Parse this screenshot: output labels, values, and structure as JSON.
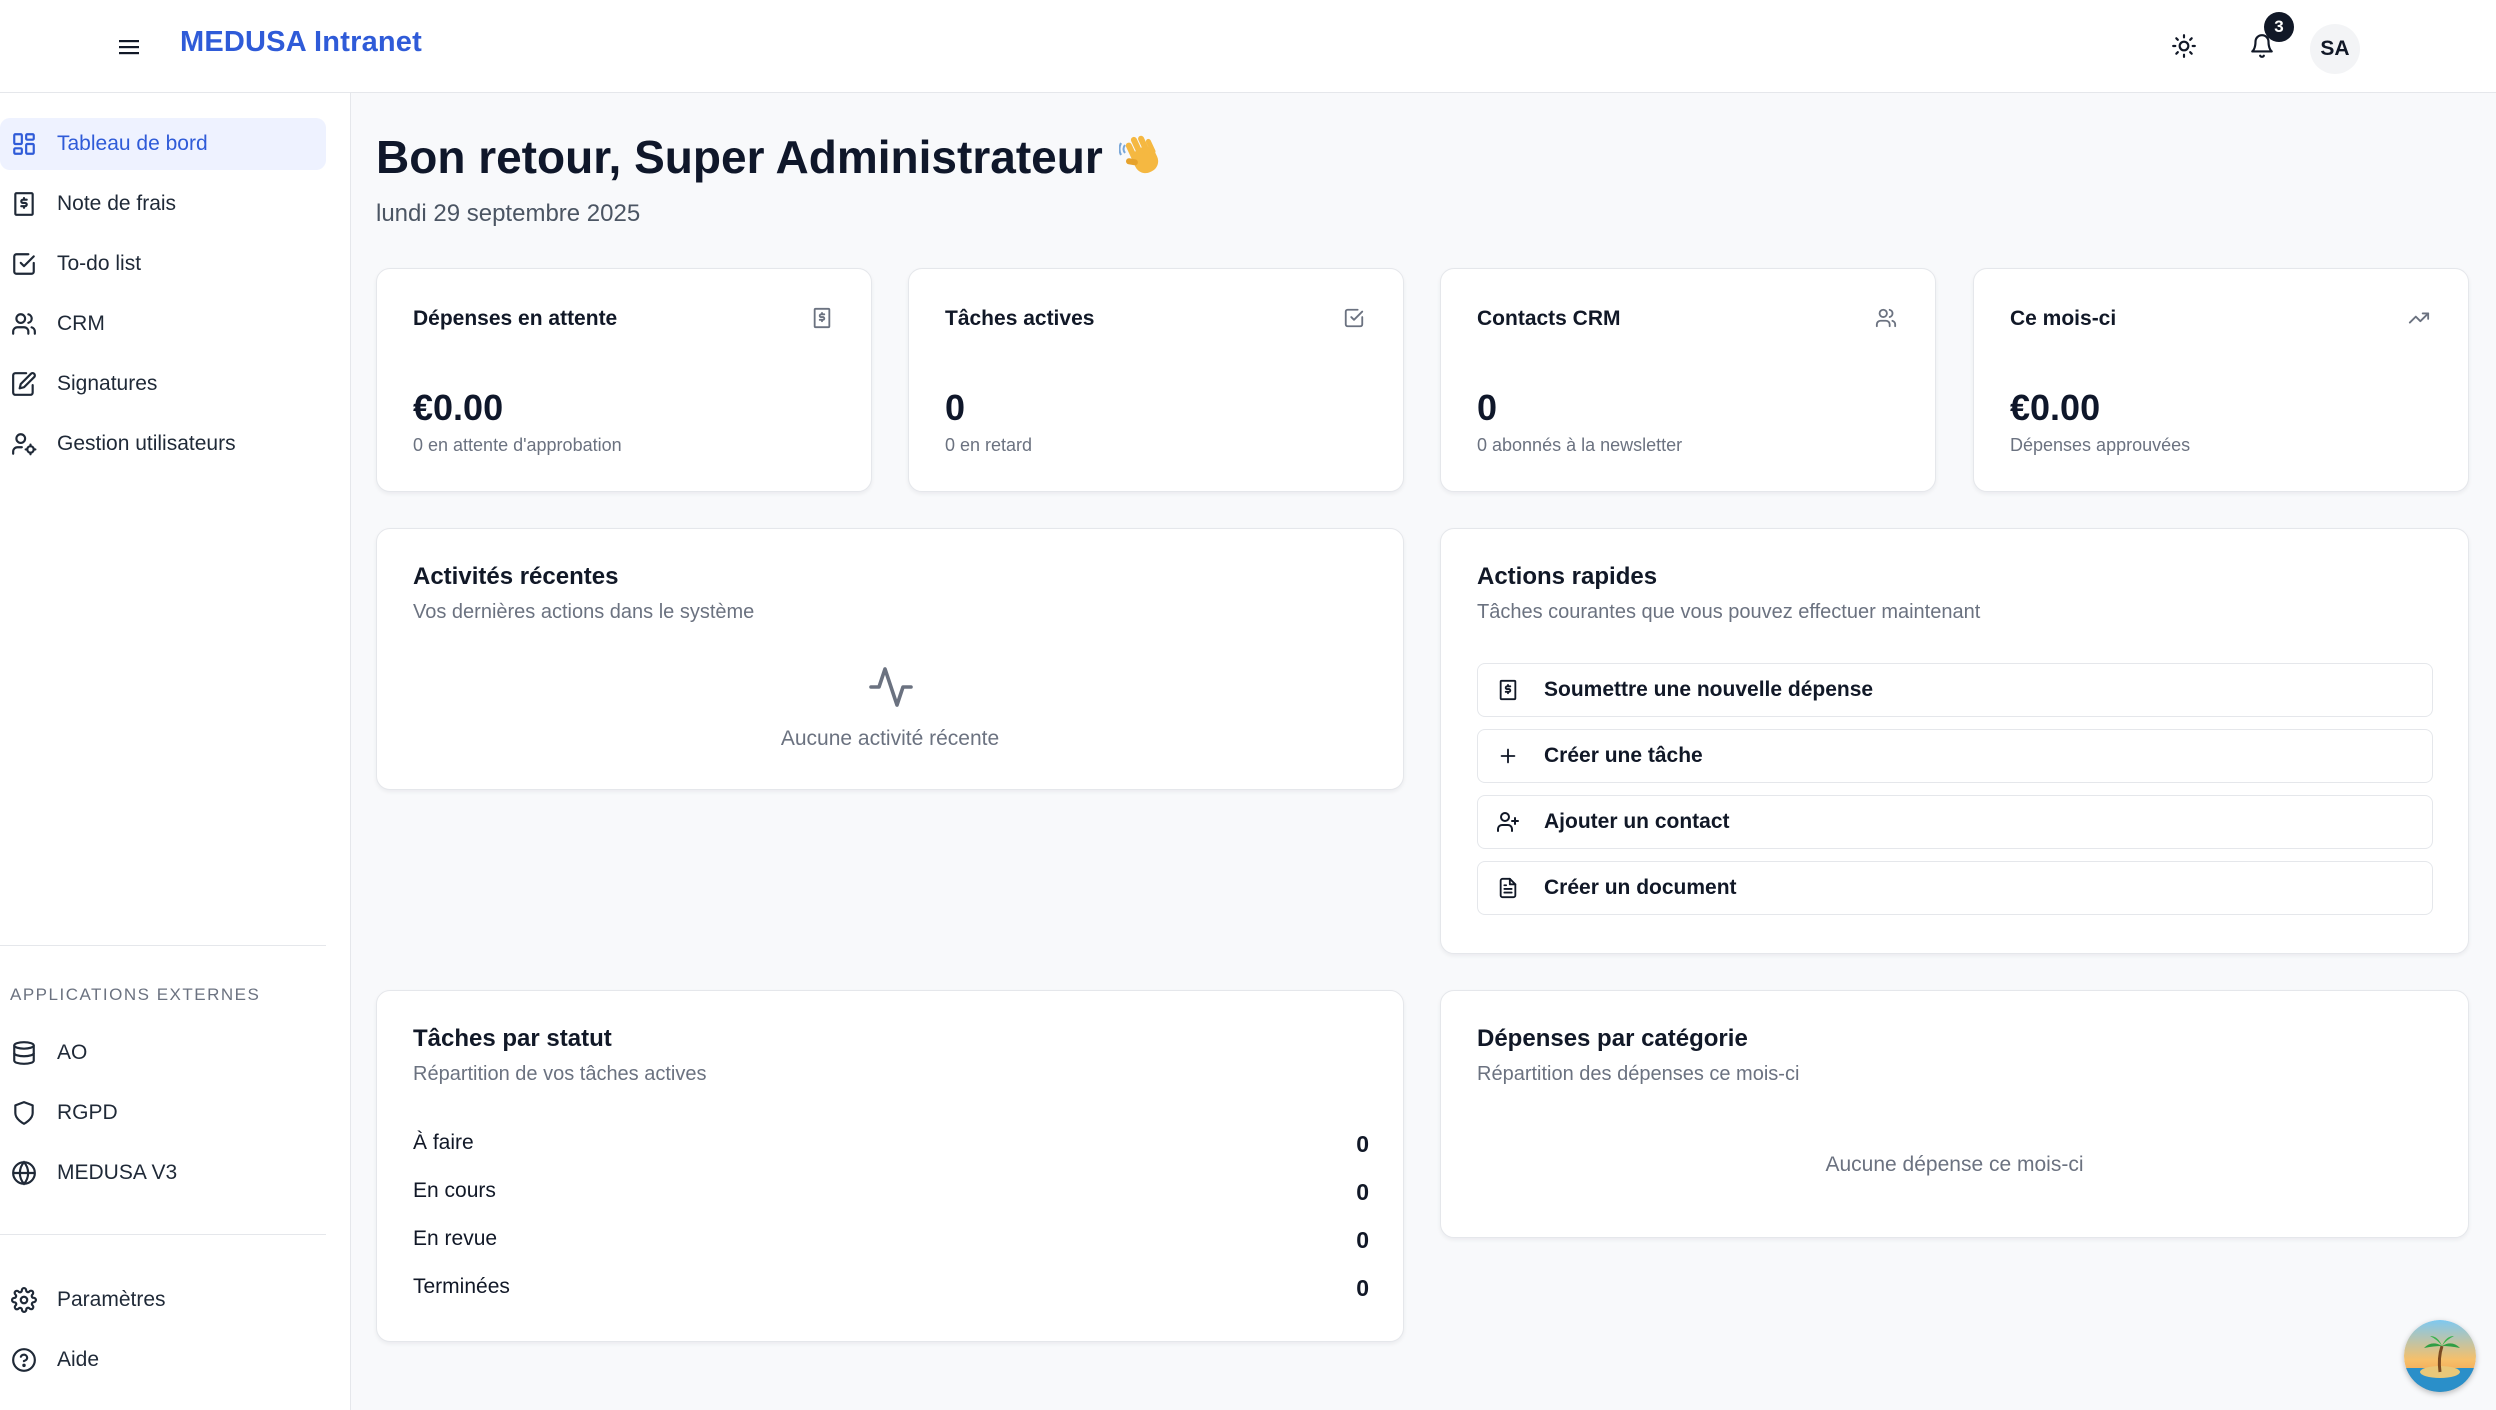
{
  "header": {
    "brand": "MEDUSA Intranet",
    "notifications_count": "3",
    "avatar_initials": "SA"
  },
  "sidebar": {
    "items": [
      {
        "label": "Tableau de bord",
        "icon": "dashboard-grid-icon",
        "active": true
      },
      {
        "label": "Note de frais",
        "icon": "receipt-dollar-icon"
      },
      {
        "label": "To-do list",
        "icon": "checkbox-icon"
      },
      {
        "label": "CRM",
        "icon": "users-icon"
      },
      {
        "label": "Signatures",
        "icon": "pen-square-icon"
      },
      {
        "label": "Gestion utilisateurs",
        "icon": "user-cog-icon"
      }
    ],
    "external_title": "APPLICATIONS EXTERNES",
    "external_items": [
      {
        "label": "AO",
        "icon": "database-icon"
      },
      {
        "label": "RGPD",
        "icon": "shield-icon"
      },
      {
        "label": "MEDUSA V3",
        "icon": "globe-icon"
      }
    ],
    "bottom_items": [
      {
        "label": "Paramètres",
        "icon": "gear-icon"
      },
      {
        "label": "Aide",
        "icon": "help-circle-icon"
      }
    ]
  },
  "main": {
    "greeting": "Bon retour, Super Administrateur",
    "greeting_emoji": "waving-hand",
    "date": "lundi 29 septembre 2025",
    "stats": [
      {
        "title": "Dépenses en attente",
        "value": "€0.00",
        "sub": "0 en attente d'approbation",
        "icon": "receipt-icon"
      },
      {
        "title": "Tâches actives",
        "value": "0",
        "sub": "0 en retard",
        "icon": "check-square-icon"
      },
      {
        "title": "Contacts CRM",
        "value": "0",
        "sub": "0 abonnés à la newsletter",
        "icon": "users-icon"
      },
      {
        "title": "Ce mois-ci",
        "value": "€0.00",
        "sub": "Dépenses approuvées",
        "icon": "trending-up-icon"
      }
    ],
    "recent": {
      "title": "Activités récentes",
      "desc": "Vos dernières actions dans le système",
      "empty": "Aucune activité récente"
    },
    "quick": {
      "title": "Actions rapides",
      "desc": "Tâches courantes que vous pouvez effectuer maintenant",
      "actions": [
        {
          "label": "Soumettre une nouvelle dépense",
          "icon": "receipt-dollar-icon"
        },
        {
          "label": "Créer une tâche",
          "icon": "plus-icon"
        },
        {
          "label": "Ajouter un contact",
          "icon": "user-plus-icon"
        },
        {
          "label": "Créer un document",
          "icon": "file-text-icon"
        }
      ]
    },
    "tasks_by_status": {
      "title": "Tâches par statut",
      "desc": "Répartition de vos tâches actives",
      "rows": [
        {
          "label": "À faire",
          "value": "0"
        },
        {
          "label": "En cours",
          "value": "0"
        },
        {
          "label": "En revue",
          "value": "0"
        },
        {
          "label": "Terminées",
          "value": "0"
        }
      ]
    },
    "expenses_by_category": {
      "title": "Dépenses par catégorie",
      "desc": "Répartition des dépenses ce mois-ci",
      "empty": "Aucune dépense ce mois-ci"
    }
  },
  "colors": {
    "accent": "#2f5bd8",
    "active_bg": "#eef2ff",
    "muted": "#6b7280"
  }
}
